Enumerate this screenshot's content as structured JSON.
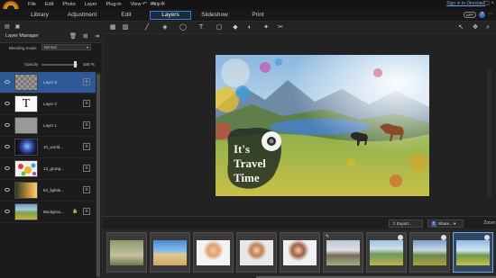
{
  "menu": {
    "items": [
      "File",
      "Edit",
      "Photo",
      "Layer",
      "Plug-in",
      "View",
      "Help"
    ],
    "sign_in": "Sign in to DirectorZ",
    "window_controls": "–  ▢  ×"
  },
  "modes": {
    "tabs": [
      "Library",
      "Adjustment",
      "Edit",
      "Layers",
      "Slideshow",
      "Print"
    ],
    "active": "Layers",
    "app_badge": "APP",
    "help_badge": "?"
  },
  "layer_manager": {
    "title": "Layer Manager",
    "blending_label": "Blending mode:",
    "blending_value": "Normal",
    "opacity_label": "Opacity",
    "opacity_value": "100 %",
    "opacity_fraction": 1.0,
    "layers": [
      {
        "name": "Layer 8",
        "thumb": "checker",
        "selected": true,
        "locked": false
      },
      {
        "name": "Layer 2",
        "thumb": "text",
        "selected": false,
        "locked": false
      },
      {
        "name": "Layer 1",
        "thumb": "grey",
        "selected": false,
        "locked": false
      },
      {
        "name": "10_world...",
        "thumb": "space",
        "selected": false,
        "locked": false
      },
      {
        "name": "13_grung...",
        "thumb": "splash",
        "selected": false,
        "locked": false
      },
      {
        "name": "84_lightle...",
        "thumb": "gradient",
        "selected": false,
        "locked": false
      },
      {
        "name": "Backgrou...",
        "thumb": "scene",
        "selected": false,
        "locked": true
      }
    ]
  },
  "canvas": {
    "headline_lines": [
      "It's",
      "Travel",
      "Time"
    ]
  },
  "bottom": {
    "export_label": "Export...",
    "share_label": "Share...",
    "zoom_label": "Zoom"
  },
  "filmstrip": {
    "frames": [
      {
        "name": "cat-photo",
        "selected": false
      },
      {
        "name": "beach-photo",
        "selected": false
      },
      {
        "name": "portrait-woman-1",
        "selected": false
      },
      {
        "name": "portrait-woman-2",
        "selected": false
      },
      {
        "name": "portrait-woman-3",
        "selected": false
      },
      {
        "name": "mountain-photo",
        "selected": false
      },
      {
        "name": "valley-photo",
        "selected": false
      },
      {
        "name": "landscape-photo",
        "selected": false
      },
      {
        "name": "travel-time-photo",
        "selected": true
      }
    ]
  },
  "colors": {
    "accent": "#3f7fd0",
    "selected_layer": "#2d5a96"
  }
}
